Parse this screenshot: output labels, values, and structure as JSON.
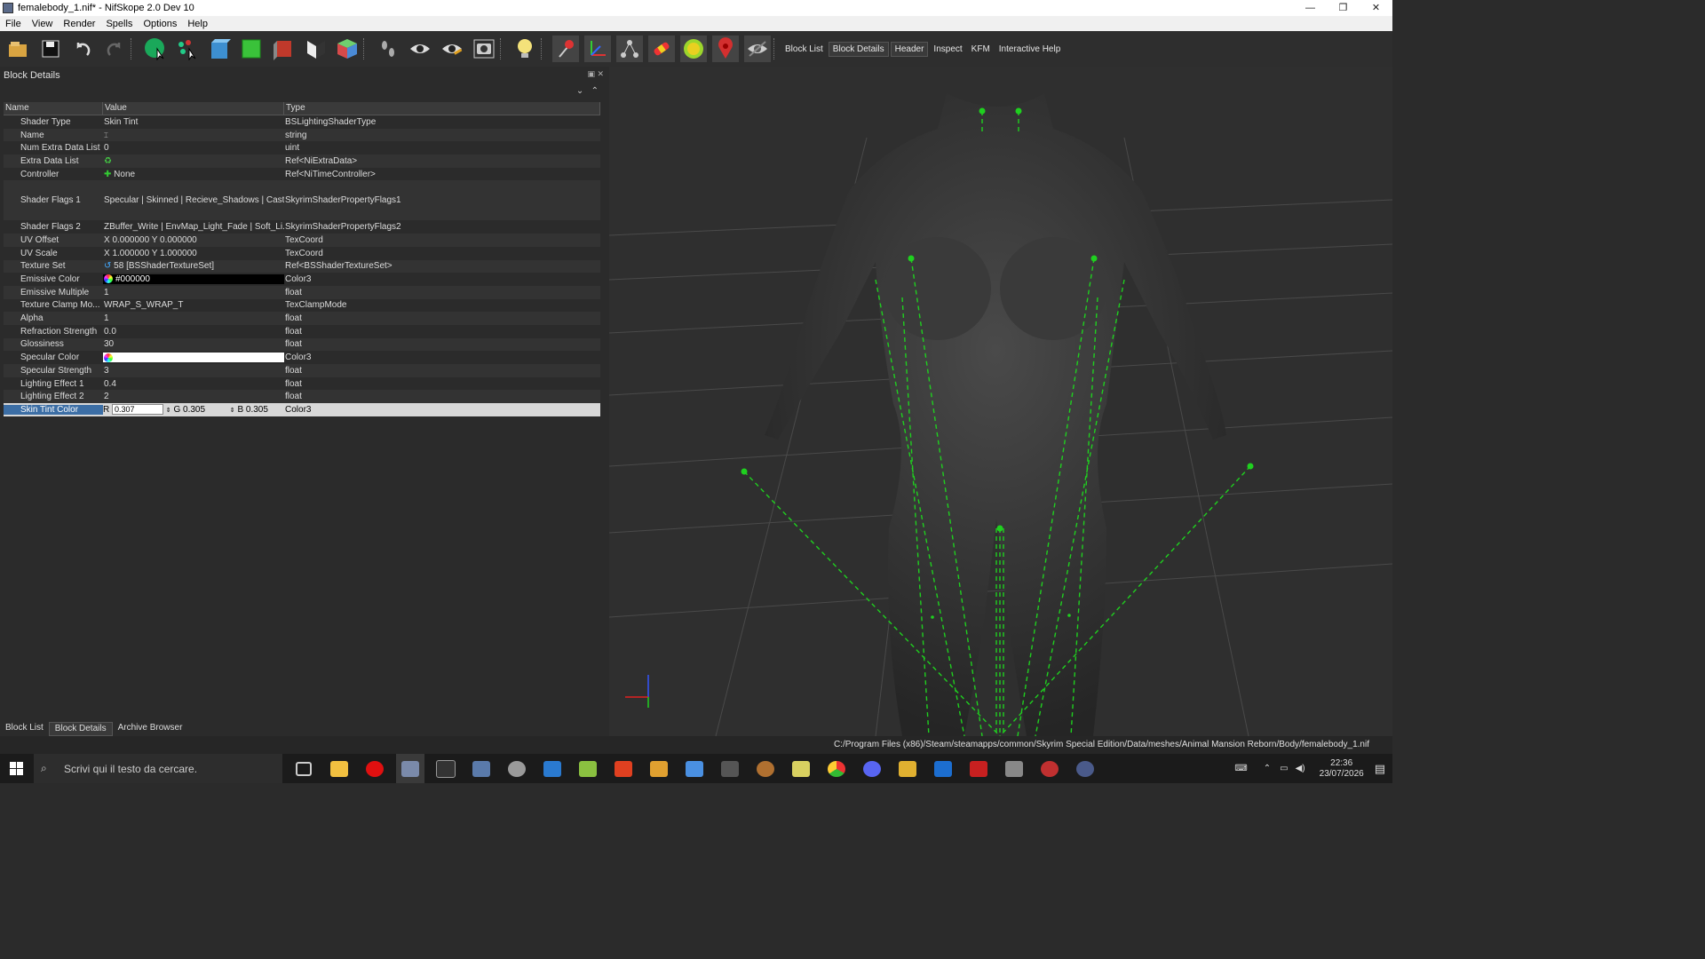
{
  "window": {
    "title": "femalebody_1.nif* - NifSkope 2.0 Dev 10",
    "controls": [
      "—",
      "❐",
      "✕"
    ]
  },
  "menu": [
    "File",
    "View",
    "Render",
    "Spells",
    "Options",
    "Help"
  ],
  "toolbar_text": [
    "Block List",
    "Block Details",
    "Header",
    "Inspect",
    "KFM",
    "Interactive Help"
  ],
  "panel": {
    "title": "Block Details",
    "headers": [
      "Name",
      "Value",
      "Type"
    ],
    "rows": [
      {
        "name": "Shader Type",
        "value": "Skin Tint",
        "type": "BSLightingShaderType"
      },
      {
        "name": "Name",
        "value": "",
        "type": "string"
      },
      {
        "name": "Num Extra Data List",
        "value": "0",
        "type": "uint"
      },
      {
        "name": "Extra Data List",
        "value": "",
        "type": "Ref<NiExtraData>"
      },
      {
        "name": "Controller",
        "value": "None",
        "type": "Ref<NiTimeController>"
      },
      {
        "name": "Shader Flags 1",
        "value": "Specular | Skinned | Recieve_Shadows | Cast_...",
        "type": "SkyrimShaderPropertyFlags1"
      },
      {
        "name": "Shader Flags 2",
        "value": "ZBuffer_Write | EnvMap_Light_Fade | Soft_Li...",
        "type": "SkyrimShaderPropertyFlags2"
      },
      {
        "name": "UV Offset",
        "value": "X 0.000000 Y 0.000000",
        "type": "TexCoord"
      },
      {
        "name": "UV Scale",
        "value": "X 1.000000 Y 1.000000",
        "type": "TexCoord"
      },
      {
        "name": "Texture Set",
        "value": "58 [BSShaderTextureSet]",
        "type": "Ref<BSShaderTextureSet>"
      },
      {
        "name": "Emissive Color",
        "value": "#000000",
        "type": "Color3"
      },
      {
        "name": "Emissive Multiple",
        "value": "1",
        "type": "float"
      },
      {
        "name": "Texture Clamp Mo...",
        "value": "WRAP_S_WRAP_T",
        "type": "TexClampMode"
      },
      {
        "name": "Alpha",
        "value": "1",
        "type": "float"
      },
      {
        "name": "Refraction Strength",
        "value": "0.0",
        "type": "float"
      },
      {
        "name": "Glossiness",
        "value": "30",
        "type": "float"
      },
      {
        "name": "Specular Color",
        "value": "",
        "type": "Color3"
      },
      {
        "name": "Specular Strength",
        "value": "3",
        "type": "float"
      },
      {
        "name": "Lighting Effect 1",
        "value": "0.4",
        "type": "float"
      },
      {
        "name": "Lighting Effect 2",
        "value": "2",
        "type": "float"
      }
    ],
    "selected_row": {
      "name": "Skin Tint Color",
      "r_label": "R",
      "r": "0.307",
      "g_label": "G",
      "g": "0.305",
      "b_label": "B",
      "b": "0.305",
      "type": "Color3"
    }
  },
  "bottom_tabs": [
    "Block List",
    "Block Details",
    "Archive Browser"
  ],
  "status_path": "C:/Program Files (x86)/Steam/steamapps/common/Skyrim Special Edition/Data/meshes/Animal Mansion Reborn/Body/femalebody_1.nif",
  "taskbar": {
    "search_placeholder": "Scrivi qui il testo da cercare.",
    "time": "22:36",
    "date": "23/07/2026"
  },
  "colors": {
    "accent": "#3c6ea5",
    "bone_green": "#1fd01f",
    "background": "#2b2b2b"
  }
}
